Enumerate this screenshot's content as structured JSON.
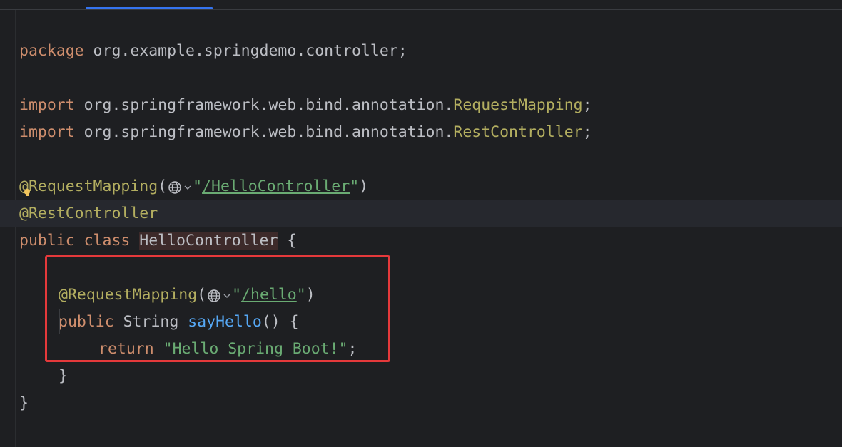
{
  "code": {
    "line_package": {
      "keyword": "package",
      "rest": " org.example.springdemo.controller;"
    },
    "line_import1": {
      "keyword": "import",
      "path": " org.springframework.web.bind.annotation.",
      "cls": "RequestMapping",
      "end": ";"
    },
    "line_import2": {
      "keyword": "import",
      "path": " org.springframework.web.bind.annotation.",
      "cls": "RestController",
      "end": ";"
    },
    "line_ann1": {
      "ann": "@RequestMapping",
      "open": "(",
      "q1": "\"",
      "link": "/HelloController",
      "q2": "\"",
      "close": ")"
    },
    "line_ann2": {
      "at": "@",
      "name": "RestController"
    },
    "line_class": {
      "kw1": "public",
      "kw2": " class ",
      "cls": "HelloController",
      "rest": " {"
    },
    "line_ann3": {
      "ann": "@RequestMapping",
      "open": "(",
      "q1": "\"",
      "link": "/hello",
      "q2": "\"",
      "close": ")"
    },
    "line_method": {
      "kw": "public",
      "type": " String ",
      "name": "sayHello",
      "rest": "() {"
    },
    "line_return": {
      "kw": "return",
      "sp": " ",
      "str": "\"Hello Spring Boot!\"",
      "end": ";"
    },
    "line_close_method": "}",
    "line_close_class": "}"
  },
  "colors": {
    "keyword": "#cf8e6d",
    "annotation": "#b3ae60",
    "string": "#6aab73",
    "method": "#56a8f5",
    "highlight_box": "#e5393b"
  },
  "icons": {
    "url_icon": "globe-icon",
    "dropdown": "chevron-down-icon",
    "intention": "lightbulb-icon"
  }
}
